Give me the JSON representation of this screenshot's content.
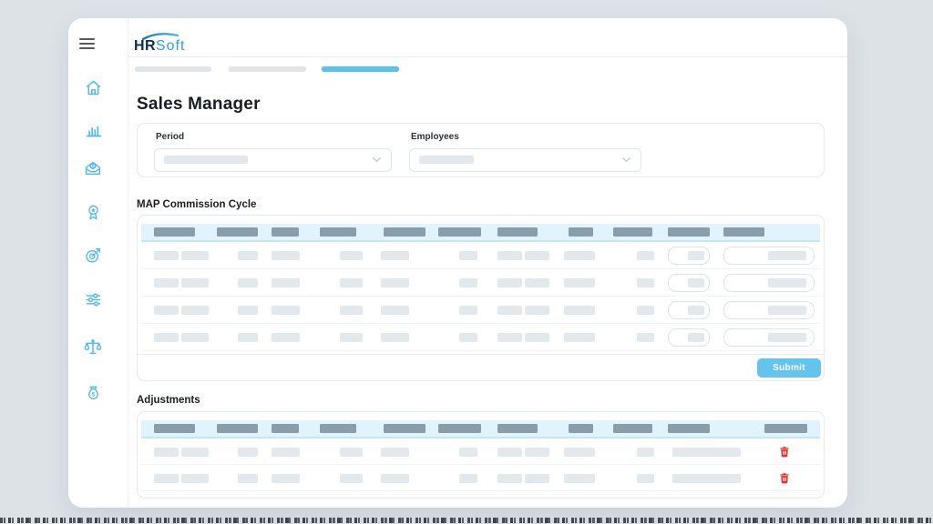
{
  "brand": {
    "hr": "HR",
    "soft": "Soft"
  },
  "page": {
    "title": "Sales Manager"
  },
  "steps": {
    "count": 3,
    "active_index": 2
  },
  "sidebar": {
    "menu_icon": "hamburger-menu-icon",
    "items": [
      {
        "icon": "home-icon"
      },
      {
        "icon": "bar-chart-icon"
      },
      {
        "icon": "mail-money-icon"
      },
      {
        "icon": "award-ribbon-icon"
      },
      {
        "icon": "target-arrow-icon"
      },
      {
        "icon": "sliders-icon"
      },
      {
        "icon": "balance-scale-icon"
      },
      {
        "icon": "money-bag-icon"
      }
    ]
  },
  "filters": {
    "period": {
      "label": "Period"
    },
    "employees": {
      "label": "Employees"
    }
  },
  "commission_table": {
    "title": "MAP Commission Cycle",
    "columns": 11,
    "rows": 4,
    "inputs_per_row": 2,
    "submit_label": "Submit"
  },
  "adjustments_table": {
    "title": "Adjustments",
    "columns": 11,
    "rows": 2,
    "delete_icon": "trash-icon"
  },
  "colors": {
    "background": "#dde2e7",
    "surface": "#ffffff",
    "accent_blue": "#57c3ef",
    "sidebar_icon_blue": "#55b9ef",
    "table_header_bg": "#e1f3fc",
    "table_header_bar": "#8a9dab",
    "skeleton_gray": "#e3e8ed",
    "submit_bg": "#63c5ed",
    "delete_red": "#e8302a",
    "brand_navy": "#0f2d4e",
    "brand_blue": "#2da0e2"
  }
}
